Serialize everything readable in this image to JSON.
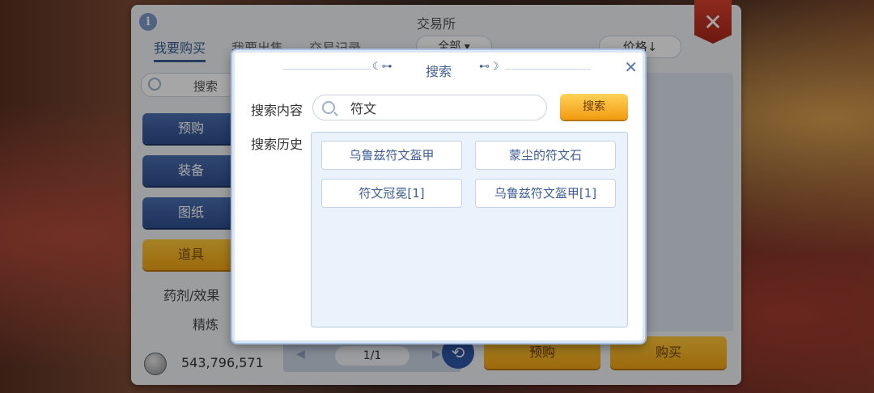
{
  "exchange": {
    "title": "交易所",
    "tabs": [
      "我要购买",
      "我要出售",
      "交易记录"
    ],
    "filter_value": "全部",
    "sort_label": "价格↓",
    "search_placeholder": "搜索",
    "categories": [
      "预购",
      "装备",
      "图纸",
      "道具"
    ],
    "subcategories": [
      "药剂/效果",
      "精炼"
    ],
    "gold": "543,796,571",
    "page": "1/1",
    "preorder_label": "预购",
    "buy_label": "购买"
  },
  "dialog": {
    "title": "搜索",
    "search_label": "搜索内容",
    "search_value": "符文",
    "search_button": "搜索",
    "history_label": "搜索历史",
    "history": [
      "乌鲁兹符文盔甲",
      "蒙尘的符文石",
      "符文冠冕[1]",
      "乌鲁兹符文盔甲[1]"
    ]
  }
}
